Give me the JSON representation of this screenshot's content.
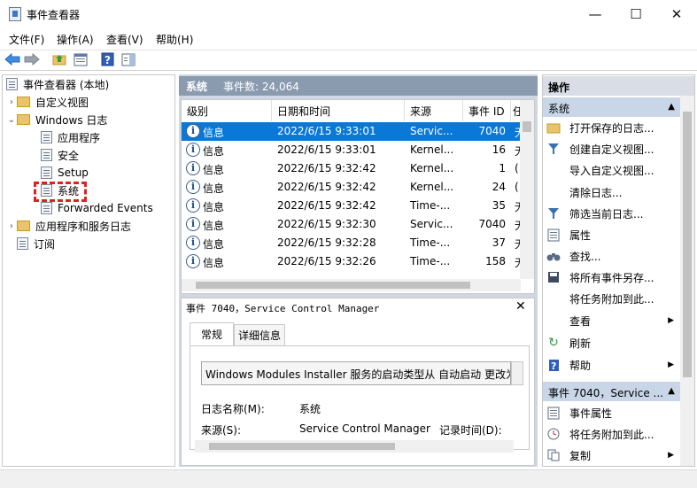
{
  "window": {
    "title": "事件查看器",
    "minimize": "—",
    "maximize": "☐",
    "close": "✕"
  },
  "menu": [
    "文件(F)",
    "操作(A)",
    "查看(V)",
    "帮助(H)"
  ],
  "toolbar": {
    "icons": [
      "back-arrow-icon",
      "forward-arrow-icon",
      "folder-up-icon",
      "properties-icon",
      "help-icon",
      "show-pane-icon"
    ]
  },
  "tree": {
    "root": "事件查看器 (本地)",
    "custom_views": "自定义视图",
    "windows_logs": "Windows 日志",
    "logs": [
      "应用程序",
      "安全",
      "Setup",
      "系统",
      "Forwarded Events"
    ],
    "app_services": "应用程序和服务日志",
    "subscriptions": "订阅"
  },
  "log_header": {
    "name": "系统",
    "count": "事件数: 24,064"
  },
  "events": {
    "columns": [
      "级别",
      "日期和时间",
      "来源",
      "事件 ID",
      "任"
    ],
    "rows": [
      {
        "level": "信息",
        "datetime": "2022/6/15 9:33:01",
        "source": "Servic...",
        "id": "7040",
        "task": "无"
      },
      {
        "level": "信息",
        "datetime": "2022/6/15 9:33:01",
        "source": "Kernel...",
        "id": "16",
        "task": "无"
      },
      {
        "level": "信息",
        "datetime": "2022/6/15 9:32:42",
        "source": "Kernel...",
        "id": "1",
        "task": "("
      },
      {
        "level": "信息",
        "datetime": "2022/6/15 9:32:42",
        "source": "Kernel...",
        "id": "24",
        "task": "("
      },
      {
        "level": "信息",
        "datetime": "2022/6/15 9:32:42",
        "source": "Time-...",
        "id": "35",
        "task": "无"
      },
      {
        "level": "信息",
        "datetime": "2022/6/15 9:32:30",
        "source": "Servic...",
        "id": "7040",
        "task": "无"
      },
      {
        "level": "信息",
        "datetime": "2022/6/15 9:32:28",
        "source": "Time-...",
        "id": "37",
        "task": "无"
      },
      {
        "level": "信息",
        "datetime": "2022/6/15 9:32:26",
        "source": "Time-...",
        "id": "158",
        "task": "无"
      }
    ]
  },
  "detail": {
    "title": "事件 7040，Service Control Manager",
    "close": "✕",
    "tabs": [
      "常规",
      "详细信息"
    ],
    "description": "Windows Modules Installer 服务的启动类型从 自动启动 更改为",
    "log_name_label": "日志名称(M):",
    "log_name_value": "系统",
    "source_label": "来源(S):",
    "source_value": "Service Control Manager",
    "logged_label": "记录时间(D):"
  },
  "actions": {
    "title": "操作",
    "section1": "系统",
    "items1": [
      {
        "label": "打开保存的日志...",
        "icon": "open-folder-icon"
      },
      {
        "label": "创建自定义视图...",
        "icon": "filter-icon"
      },
      {
        "label": "导入自定义视图...",
        "icon": ""
      },
      {
        "label": "清除日志...",
        "icon": ""
      },
      {
        "label": "筛选当前日志...",
        "icon": "filter-icon"
      },
      {
        "label": "属性",
        "icon": "properties-icon"
      },
      {
        "label": "查找...",
        "icon": "binoculars-icon"
      },
      {
        "label": "将所有事件另存...",
        "icon": "save-icon"
      },
      {
        "label": "将任务附加到此...",
        "icon": ""
      },
      {
        "label": "查看",
        "icon": ""
      },
      {
        "label": "刷新",
        "icon": "refresh-icon"
      },
      {
        "label": "帮助",
        "icon": "help-icon"
      }
    ],
    "section2": "事件 7040，Service ...",
    "items2": [
      {
        "label": "事件属性",
        "icon": "properties-icon"
      },
      {
        "label": "将任务附加到此...",
        "icon": "clock-icon"
      },
      {
        "label": "复制",
        "icon": "copy-icon"
      }
    ]
  },
  "colors": {
    "selection": "#0a78d7",
    "header_bg": "#8a9bb0",
    "highlight": "#e02020"
  }
}
